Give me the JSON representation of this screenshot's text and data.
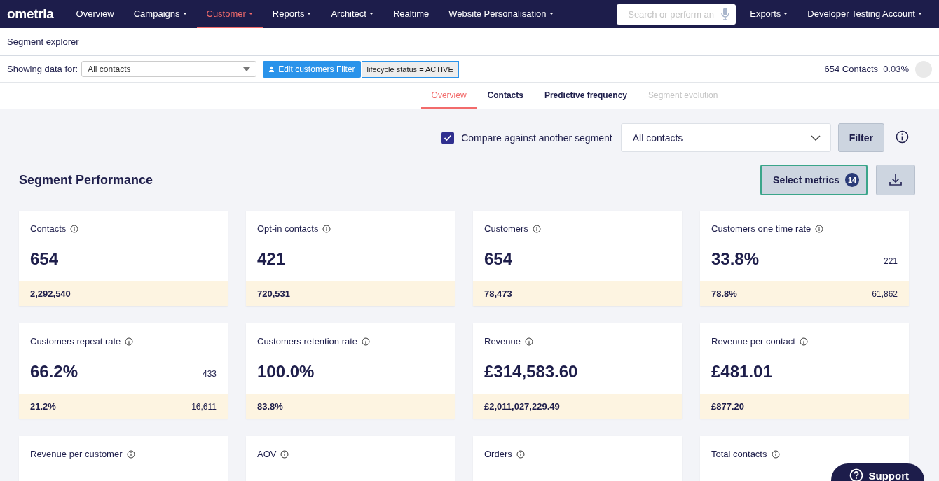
{
  "nav": {
    "logo": "ometria",
    "items": [
      {
        "label": "Overview",
        "dropdown": false,
        "selected": false
      },
      {
        "label": "Campaigns",
        "dropdown": true,
        "selected": false
      },
      {
        "label": "Customer",
        "dropdown": true,
        "selected": true
      },
      {
        "label": "Reports",
        "dropdown": true,
        "selected": false
      },
      {
        "label": "Architect",
        "dropdown": true,
        "selected": false
      },
      {
        "label": "Realtime",
        "dropdown": false,
        "selected": false
      },
      {
        "label": "Website Personalisation",
        "dropdown": true,
        "selected": false
      }
    ],
    "search_placeholder": "Search or perform an",
    "right_items": [
      {
        "label": "Exports",
        "dropdown": true
      },
      {
        "label": "Developer Testing Account",
        "dropdown": true
      }
    ]
  },
  "page_title": "Segment explorer",
  "filter_bar": {
    "label": "Showing data for:",
    "segment": "All contacts",
    "edit_button": "Edit customers Filter",
    "filter_tag": "lifecycle status = ACTIVE",
    "contacts": "654 Contacts",
    "percent": "0.03%"
  },
  "tabs": [
    {
      "label": "Overview",
      "selected": true,
      "disabled": false
    },
    {
      "label": "Contacts",
      "selected": false,
      "disabled": false
    },
    {
      "label": "Predictive frequency",
      "selected": false,
      "disabled": false
    },
    {
      "label": "Segment evolution",
      "selected": false,
      "disabled": true
    }
  ],
  "compare": {
    "checked": true,
    "label": "Compare against another segment",
    "segment": "All contacts",
    "filter_button": "Filter"
  },
  "section_title": "Segment Performance",
  "select_metrics": {
    "label": "Select metrics",
    "count": "14"
  },
  "cards": [
    {
      "title": "Contacts",
      "value": "654",
      "compare": "2,292,540"
    },
    {
      "title": "Opt-in contacts",
      "value": "421",
      "compare": "720,531"
    },
    {
      "title": "Customers",
      "value": "654",
      "compare": "78,473"
    },
    {
      "title": "Customers one time rate",
      "value": "33.8%",
      "value_aside": "221",
      "compare": "78.8%",
      "compare_aside": "61,862"
    },
    {
      "title": "Customers repeat rate",
      "value": "66.2%",
      "value_aside": "433",
      "compare": "21.2%",
      "compare_aside": "16,611"
    },
    {
      "title": "Customers retention rate",
      "value": "100.0%",
      "compare": "83.8%"
    },
    {
      "title": "Revenue",
      "value": "£314,583.60",
      "compare": "£2,011,027,229.49"
    },
    {
      "title": "Revenue per contact",
      "value": "£481.01",
      "compare": "£877.20"
    },
    {
      "title": "Revenue per customer"
    },
    {
      "title": "AOV"
    },
    {
      "title": "Orders"
    },
    {
      "title": "Total contacts"
    }
  ],
  "support_button": "Support"
}
